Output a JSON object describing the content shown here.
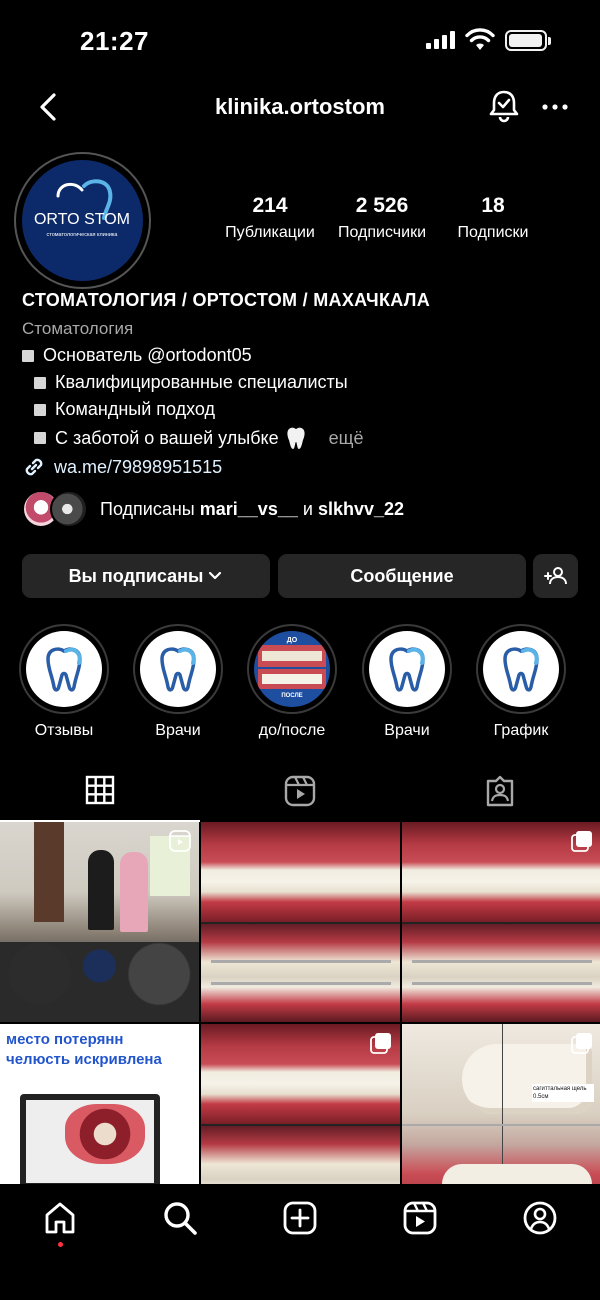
{
  "status_bar": {
    "time": "21:27"
  },
  "nav": {
    "title": "klinika.ortostom"
  },
  "profile": {
    "avatar_text": "ORTO STOM",
    "avatar_subtext": "стоматологическая клиника",
    "stats": [
      {
        "value": "214",
        "label": "Публикации"
      },
      {
        "value": "2 526",
        "label": "Подписчики"
      },
      {
        "value": "18",
        "label": "Подписки"
      }
    ],
    "name": "СТОМАТОЛОГИЯ / ОРТОСТОМ / МАХАЧКАЛА",
    "category": "Стоматология",
    "bio_lines": [
      "Основатель @ortodont05",
      "Квалифицированные специалисты",
      "Командный подход",
      "С заботой о вашей улыбке"
    ],
    "more_label": "ещё",
    "link": "wa.me/79898951515",
    "followed_by_prefix": "Подписаны",
    "followed_by_user1": "mari__vs__",
    "followed_by_and": "и",
    "followed_by_user2": "slkhvv_22"
  },
  "actions": {
    "following_label": "Вы подписаны",
    "message_label": "Сообщение"
  },
  "highlights": [
    {
      "label": "Отзывы"
    },
    {
      "label": "Врачи"
    },
    {
      "label": "до/после",
      "top_text": "ДО",
      "bottom_text": "ПОСЛЕ"
    },
    {
      "label": "Врачи"
    },
    {
      "label": "График"
    }
  ],
  "grid": {
    "post4_caption_line1": "место потерянн",
    "post4_caption_line2": "челюсть искривлена",
    "post6_annotation": "сагиттальная щель 0.5см"
  },
  "colors": {
    "background": "#000000",
    "button": "#262626",
    "link": "#e0f1ff",
    "secondary_text": "#a8a8a8",
    "avatar_bg": "#0c2a6a",
    "notification_dot": "#ff3040"
  }
}
